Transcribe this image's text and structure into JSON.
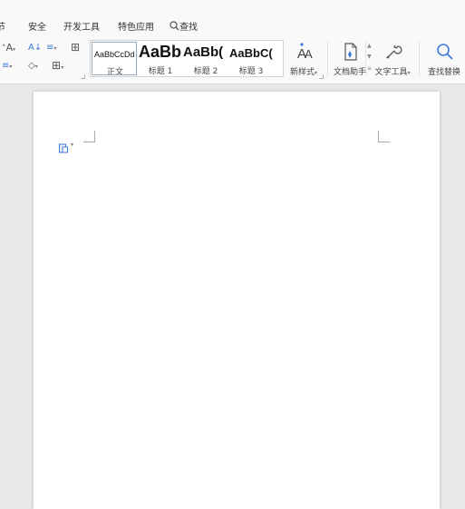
{
  "menu": {
    "items": [
      "节",
      "安全",
      "开发工具",
      "特色应用"
    ],
    "search_label": "查找"
  },
  "ribbon": {
    "font_group": {
      "grow_font_label": "A",
      "sort_label": "A↓",
      "paragraph_spacing_label": "≡",
      "border_label": "⊞",
      "list_label": "≡",
      "shading_label": "◇",
      "table_border_label": "⊞"
    },
    "styles": [
      {
        "preview": "AaBbCcDd",
        "label": "正文"
      },
      {
        "preview": "AaBb",
        "label": "标题 1"
      },
      {
        "preview": "AaBb(",
        "label": "标题 2"
      },
      {
        "preview": "AaBbC(",
        "label": "标题 3"
      }
    ],
    "new_style_label": "新样式",
    "doc_assistant_label": "文档助手",
    "text_tools_label": "文字工具",
    "find_replace_label": "查找替换"
  },
  "colors": {
    "accent": "#3c7ad9",
    "background": "#e8e8e8",
    "ribbon_bg": "#f9f9f9"
  }
}
